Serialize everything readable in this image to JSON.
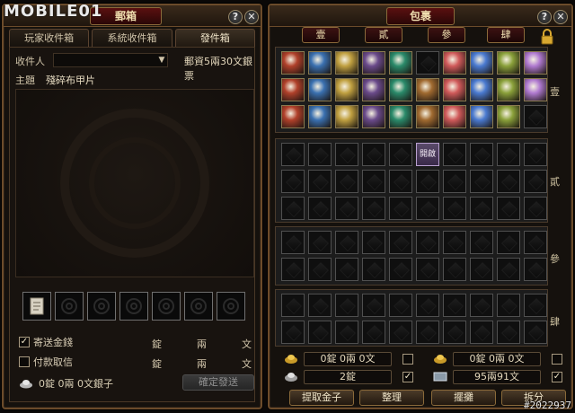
{
  "watermark": {
    "brand": "MOBILE01",
    "id": "#2022937"
  },
  "mail": {
    "title": "郵箱",
    "help": "?",
    "close": "✕",
    "tabs": [
      {
        "label": "玩家收件箱",
        "active": false
      },
      {
        "label": "系統收件箱",
        "active": false
      },
      {
        "label": "發件箱",
        "active": true
      }
    ],
    "recipient_label": "收件人",
    "recipient_value": "",
    "postage": "郵資5兩30文銀票",
    "subject_label": "主題",
    "subject_value": "殘碎布甲片",
    "attachment_slots": 7,
    "attachment_first_item": "paper-scroll",
    "send_money": {
      "label": "寄送金錢",
      "checked": true,
      "unit_ding": "錠",
      "unit_liang": "兩",
      "unit_wen": "文"
    },
    "cod": {
      "label": "付款取信",
      "checked": false,
      "unit_ding": "錠",
      "unit_liang": "兩",
      "unit_wen": "文"
    },
    "balance": "0錠 0兩 0文銀子",
    "confirm_button": "確定發送"
  },
  "bag": {
    "title": "包裹",
    "help": "?",
    "close": "✕",
    "pages": [
      "壹",
      "貳",
      "參",
      "肆"
    ],
    "section_labels": [
      "壹",
      "貳",
      "參",
      "肆"
    ],
    "new_tag": "開啟",
    "money": {
      "gold_top": "0錠 0兩 0文",
      "gold_top_right": "0錠 0兩 0文",
      "silver_left": "2錠",
      "silver_right": "95兩91文"
    },
    "buttons": {
      "withdraw": "提取金子",
      "sort": "整理",
      "stall": "擺攤",
      "split": "拆分"
    }
  },
  "colors": {
    "frame": "#6b4b2a",
    "title_plate": "#5a1010",
    "text": "#d8cdb5"
  }
}
